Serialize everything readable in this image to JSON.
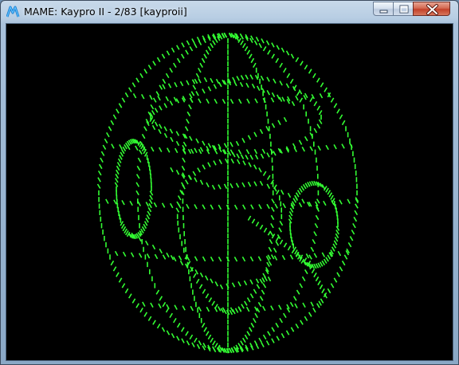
{
  "window": {
    "title": "MAME: Kaypro II - 2/83 [kayproii]",
    "app_icon": "mame-icon",
    "controls": {
      "minimize": "minimize-icon",
      "maximize": "maximize-icon",
      "close": "close-icon"
    }
  },
  "screen": {
    "description_icon": "ascii-globe-art",
    "background": "#000000",
    "phosphor": "#33ff33"
  },
  "colors": {
    "titlebar": "#b9cfe5",
    "close_button": "#c94a33"
  }
}
